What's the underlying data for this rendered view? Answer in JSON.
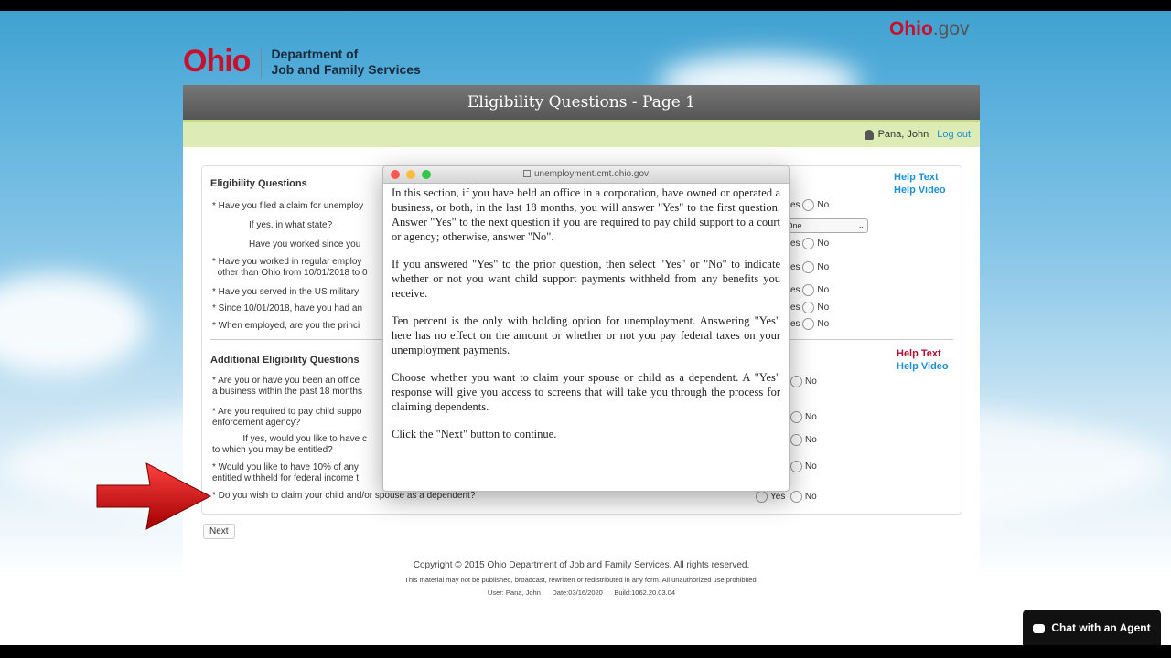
{
  "site": {
    "portal": "Ohio.gov",
    "portal_o": "Ohio",
    "portal_rest": ".gov",
    "logo_word": "Ohio",
    "dept_line1": "Department of",
    "dept_line2": "Job and Family Services"
  },
  "page": {
    "title": "Eligibility Questions - Page 1",
    "user": "Pana, John",
    "logout": "Log out"
  },
  "eligibility": {
    "title": "Eligibility Questions",
    "help_text": "Help Text",
    "help_video": "Help Video",
    "questions": [
      "Have you filed a claim for unemploy",
      "If yes, in what state?",
      "Have you worked since you",
      "Have you worked in regular employ",
      "Have you served in the US military",
      "Since 10/01/2018, have you had an",
      "When employed, are you the princi"
    ],
    "q4_line2": "other than Ohio from 10/01/2018 to 0",
    "select_value": "ct One"
  },
  "additional": {
    "title": "Additional Eligibility Questions",
    "help_text": "Help Text",
    "help_video": "Help Video",
    "q1_a": "Are you or have you been an office",
    "q1_b": "a business within the past 18 months",
    "q2_a": "Are you required to pay child suppo",
    "q2_b": "enforcement agency?",
    "q3_a": "If yes, would you like to have c",
    "q3_b": "to which you may be entitled?",
    "q4_a": "Would you like to have 10% of any",
    "q4_b": "entitled withheld for federal income t",
    "q5": "Do you wish to claim your child and/or spouse as a dependent?"
  },
  "radio": {
    "yes": "Yes",
    "yes_partial": "es",
    "no": "No"
  },
  "next_button": "Next",
  "footer": {
    "copyright": "Copyright © 2015 Ohio Department of Job and Family Services. All rights reserved.",
    "notice": "This material may not be published, broadcast, rewritten or redistributed in any form. All unauthorized use prohibited.",
    "build": "User: Pana, John      Date:03/16/2020      Build:1062.20.03.04"
  },
  "popup": {
    "url": "unemployment.cmt.ohio.gov",
    "paragraphs": [
      "In this section, if you have held an office in a corporation, have owned or operated a business, or both, in the last 18 months, you will answer \"Yes\" to the first question. Answer \"Yes\" to the next question if you are required to pay child support to a court or agency; otherwise, answer \"No\".",
      "If you answered \"Yes\" to the prior question, then select \"Yes\" or \"No\" to indicate whether or not you want child support payments withheld from any benefits you receive.",
      "Ten percent is the only with holding option for unemployment. Answering \"Yes\" here has no effect on the amount or whether or not you pay federal taxes on your unemployment payments.",
      "Choose whether you want to claim your spouse or child as a dependent. A \"Yes\" response will give you access to screens that will take you through the process for claiming dependents.",
      "Click the \"Next\" button to continue."
    ]
  },
  "chat": {
    "label": "Chat with an Agent"
  },
  "colors": {
    "brand_red": "#c8102e",
    "header_gray": "#5a5a5a",
    "user_bar_green": "#dcecb4",
    "link_blue": "#1e90d0"
  }
}
